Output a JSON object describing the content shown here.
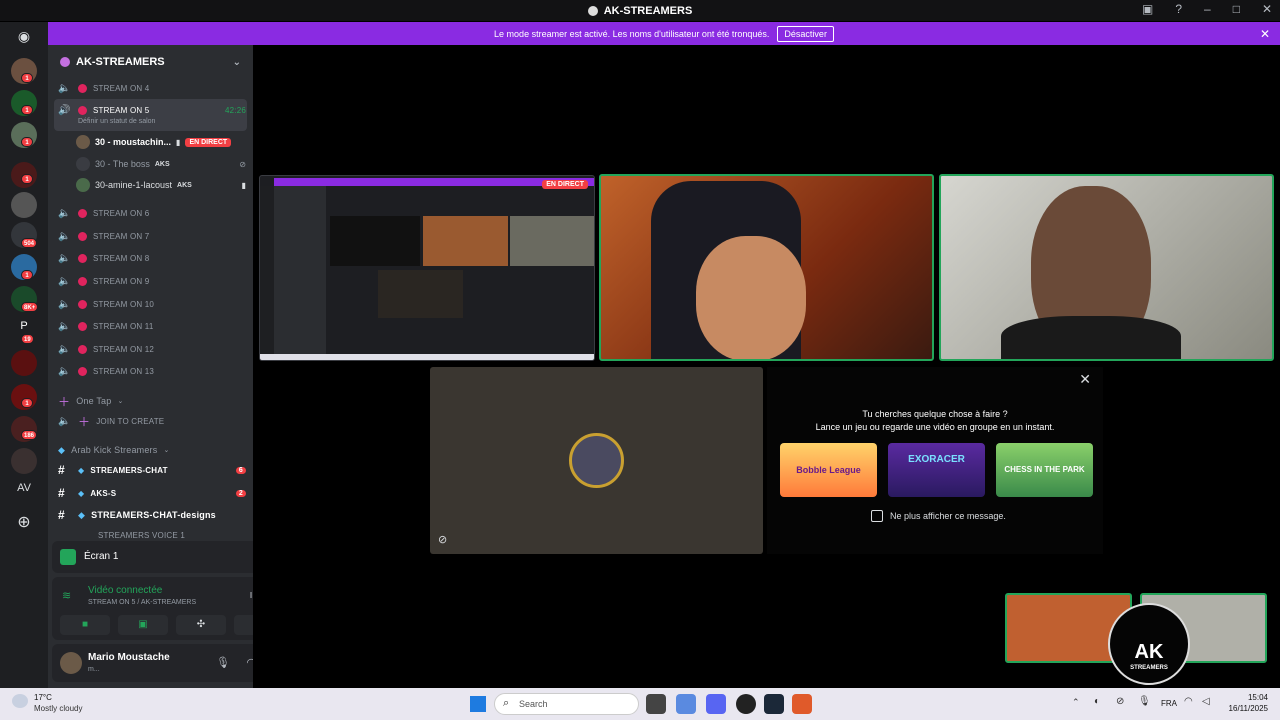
{
  "window": {
    "title": "AK-STREAMERS"
  },
  "banner": {
    "text": "Le mode streamer est activé. Les noms d'utilisateur ont été tronqués.",
    "button": "Désactiver"
  },
  "rail": {
    "home": "discord-icon",
    "badges": [
      "1",
      "1",
      "1",
      "1",
      "504",
      "1",
      "8K+",
      "19",
      "1",
      "1",
      "186"
    ],
    "av_label": "AV",
    "p_label": "P"
  },
  "server": {
    "name": "AK-STREAMERS"
  },
  "channels": {
    "stream4": "STREAM ON 4",
    "stream5": "STREAM ON 5",
    "stream5_time": "42:26",
    "stream5_status": "Définir un statut de salon",
    "members": [
      {
        "name": "30 - moustachin...",
        "badge": "EN DIRECT"
      },
      {
        "name": "30 - The boss",
        "tag": "AKS"
      },
      {
        "name": "30-amine-1-lacoust",
        "tag": "AKS"
      }
    ],
    "voice": [
      "STREAM ON 6",
      "STREAM ON 7",
      "STREAM ON 8",
      "STREAM ON 9",
      "STREAM ON 10",
      "STREAM ON 11",
      "STREAM ON 12",
      "STREAM ON 13"
    ],
    "one_tap": "One Tap",
    "join": "JOIN TO CREATE",
    "category": "Arab Kick Streamers",
    "text": [
      {
        "name": "STREAMERS-CHAT",
        "badge": "6"
      },
      {
        "name": "AKS-S",
        "badge": "2"
      },
      {
        "name": "STREAMERS-CHAT-designs",
        "badge": ""
      }
    ],
    "cut": "STREAMERS VOICE 1"
  },
  "screen_panel": {
    "label": "Écran 1"
  },
  "voice_panel": {
    "status": "Vidéo connectée",
    "channel": "STREAM ON 5 / AK-STREAMERS"
  },
  "user": {
    "name": "Mario Moustache",
    "sub": "m..."
  },
  "stage": {
    "live_badge": "EN DIRECT",
    "activity_title": "Tu cherches quelque chose à faire ?",
    "activity_sub": "Lance un jeu ou regarde une vidéo en groupe en un instant.",
    "games": [
      "Bobble League",
      "EXORACER",
      "CHESS IN THE PARK"
    ],
    "dont_show": "Ne plus afficher ce message."
  },
  "overlay": {
    "logo_main": "AK",
    "logo_sub": "STREAMERS"
  },
  "taskbar": {
    "weather_temp": "17°C",
    "weather_desc": "Mostly cloudy",
    "search": "Search",
    "lang": "FRA",
    "time": "15:04",
    "date": "16/11/2025"
  }
}
